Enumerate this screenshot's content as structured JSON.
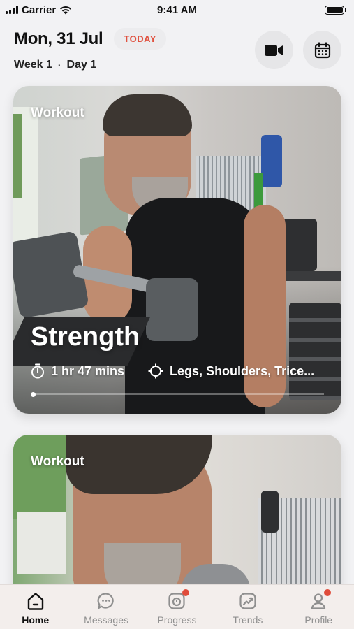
{
  "status_bar": {
    "carrier": "Carrier",
    "time": "9:41 AM"
  },
  "header": {
    "date": "Mon, 31 Jul",
    "today_badge": "TODAY",
    "week": "Week 1",
    "separator": "·",
    "day": "Day 1",
    "actions": [
      {
        "icon": "video-camera-icon"
      },
      {
        "icon": "calendar-icon"
      }
    ]
  },
  "cards": [
    {
      "label": "Workout",
      "title": "Strength",
      "duration": "1 hr 47 mins",
      "focus": "Legs, Shoulders, Trice...",
      "progress": 0.0,
      "icons": {
        "duration": "stopwatch-icon",
        "focus": "target-icon"
      }
    },
    {
      "label": "Workout"
    }
  ],
  "tab_bar": {
    "tabs": [
      {
        "label": "Home",
        "icon": "home-icon",
        "active": true,
        "badge": false
      },
      {
        "label": "Messages",
        "icon": "chat-icon",
        "active": false,
        "badge": false
      },
      {
        "label": "Progress",
        "icon": "progress-icon",
        "active": false,
        "badge": true
      },
      {
        "label": "Trends",
        "icon": "trends-icon",
        "active": false,
        "badge": false
      },
      {
        "label": "Profile",
        "icon": "profile-icon",
        "active": false,
        "badge": true
      }
    ]
  },
  "colors": {
    "accent": "#e0513f",
    "badge": "#e04b3a",
    "inactive_tab": "#8f8f8f"
  }
}
